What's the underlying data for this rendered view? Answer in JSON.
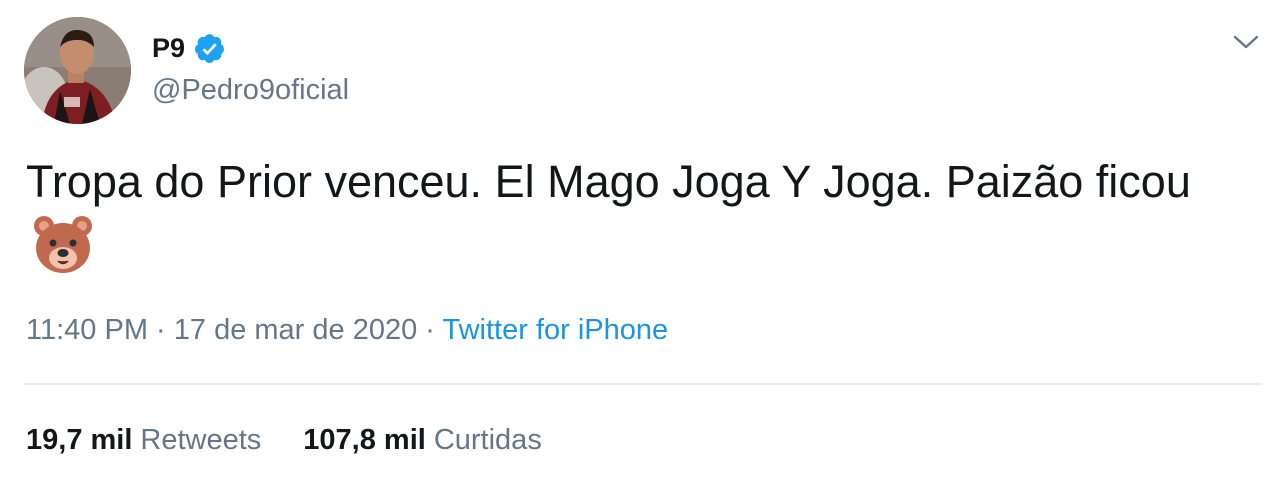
{
  "author": {
    "display_name": "P9",
    "handle": "@Pedro9oficial",
    "verified": true,
    "verified_color": "#1da1f2",
    "avatar_icon": "profile-photo"
  },
  "menu": {
    "icon": "chevron-down-icon"
  },
  "tweet": {
    "text": "Tropa do Prior venceu. El Mago Joga Y Joga. Paizão ficou",
    "emoji": "bear-face-emoji"
  },
  "meta": {
    "time": "11:40 PM",
    "separator1": " · ",
    "date": "17 de mar de 2020",
    "separator2": " · ",
    "source": "Twitter for iPhone",
    "source_color": "#1b95e0"
  },
  "stats": {
    "retweets": {
      "count": "19,7 mil",
      "label": "Retweets"
    },
    "likes": {
      "count": "107,8 mil",
      "label": "Curtidas"
    }
  }
}
